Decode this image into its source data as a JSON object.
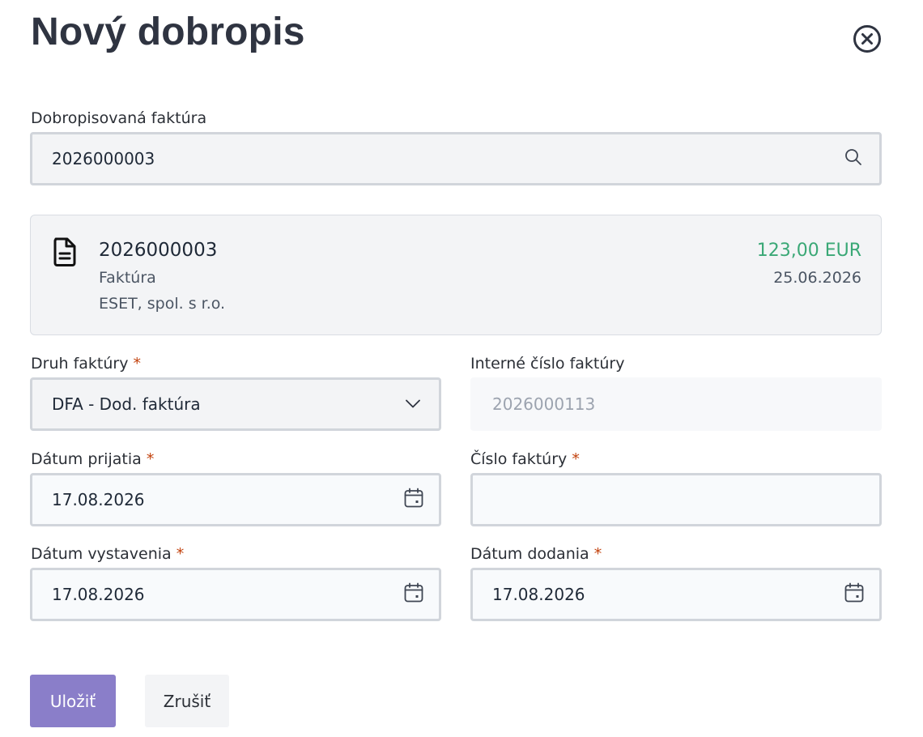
{
  "title": "Nový dobropis",
  "invoice_search": {
    "label": "Dobropisovaná faktúra",
    "value": "2026000003"
  },
  "invoice_card": {
    "number": "2026000003",
    "type": "Faktúra",
    "company": "ESET, spol. s r.o.",
    "amount": "123,00 EUR",
    "date": "25.06.2026",
    "amount_color": "#3aa876"
  },
  "form": {
    "invoice_kind": {
      "label": "Druh faktúry",
      "required": "*",
      "value": "DFA - Dod. faktúra"
    },
    "internal_number": {
      "label": "Interné číslo faktúry",
      "value": "2026000113"
    },
    "received_date": {
      "label": "Dátum prijatia",
      "required": "*",
      "value": "17.08.2026"
    },
    "invoice_number": {
      "label": "Číslo faktúry",
      "required": "*",
      "value": ""
    },
    "issue_date": {
      "label": "Dátum vystavenia",
      "required": "*",
      "value": "17.08.2026"
    },
    "delivery_date": {
      "label": "Dátum dodania",
      "required": "*",
      "value": "17.08.2026"
    }
  },
  "buttons": {
    "save": "Uložiť",
    "cancel": "Zrušiť",
    "save_color": "#8a7ec9"
  },
  "icons": {
    "close": "close-circle-icon",
    "search": "search-icon",
    "document": "document-icon",
    "dropdown": "chevron-down-icon",
    "calendar": "calendar-icon"
  }
}
